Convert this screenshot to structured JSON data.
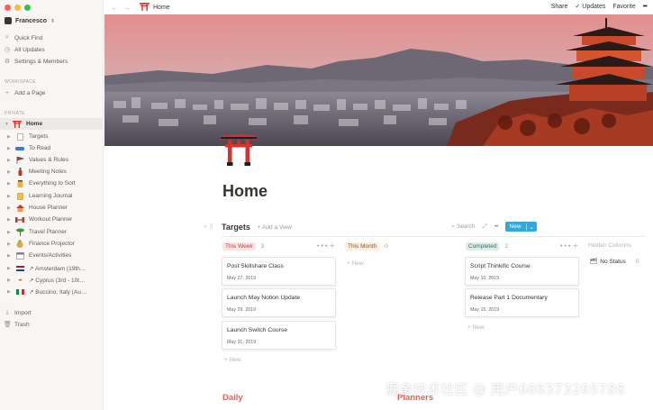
{
  "window": {
    "traffic_colors": [
      "#ff5f57",
      "#febc2e",
      "#28c840"
    ]
  },
  "sidebar": {
    "workspace": "Francesco",
    "top_items": [
      {
        "icon": "search-icon",
        "label": "Quick Find"
      },
      {
        "icon": "clock-icon",
        "label": "All Updates"
      },
      {
        "icon": "gear-icon",
        "label": "Settings & Members"
      }
    ],
    "workspace_label": "WORKSPACE",
    "add_page": "Add a Page",
    "private_label": "PRIVATE",
    "pages": [
      {
        "label": "Home",
        "icon": "torii-icon",
        "active": true,
        "indent": 0
      },
      {
        "label": "Targets",
        "icon": "document-icon",
        "indent": 1
      },
      {
        "label": "To Read",
        "icon": "car-icon",
        "indent": 1
      },
      {
        "label": "Values & Rules",
        "icon": "flag-icon",
        "indent": 1
      },
      {
        "label": "Meeting Notes",
        "icon": "bottle-icon",
        "indent": 1
      },
      {
        "label": "Everything to Sort",
        "icon": "jar-icon",
        "indent": 1
      },
      {
        "label": "Learning Journal",
        "icon": "notebook-icon",
        "indent": 1
      },
      {
        "label": "House Planner",
        "icon": "house-icon",
        "indent": 1
      },
      {
        "label": "Workout Planner",
        "icon": "dumbbell-icon",
        "indent": 1
      },
      {
        "label": "Travel Planner",
        "icon": "palm-tree-icon",
        "indent": 1
      },
      {
        "label": "Finance Projector",
        "icon": "money-bag-icon",
        "indent": 1
      },
      {
        "label": "Events/Activities",
        "icon": "calendar-icon",
        "indent": 1
      },
      {
        "label": "↗ Amsterdam (19th…",
        "icon": "netherlands-flag-icon",
        "indent": 1
      },
      {
        "label": "↗ Cyprus (3rd - 10t…",
        "icon": "cyprus-flag-icon",
        "indent": 1
      },
      {
        "label": "↗ Buccino, Italy (Au…",
        "icon": "italy-flag-icon",
        "indent": 1
      }
    ],
    "bottom_items": [
      {
        "icon": "import-icon",
        "label": "Import"
      },
      {
        "icon": "trash-icon",
        "label": "Trash"
      }
    ]
  },
  "topbar": {
    "breadcrumb": "Home",
    "share": "Share",
    "updates": "Updates",
    "favorite": "Favorite",
    "more": "•••"
  },
  "page": {
    "title": "Home"
  },
  "board": {
    "title": "Targets",
    "add_view": "+ Add a View",
    "search": "Search",
    "more": "•••",
    "new_label": "New",
    "add_new": "+ New",
    "hidden_columns": "Hidden Columns",
    "columns": [
      {
        "label": "This Week",
        "count": "3",
        "tag_bg": "#fbe4e4",
        "tag_color": "#b34a45"
      },
      {
        "label": "This Month",
        "count": "0",
        "tag_bg": "#fbeee0",
        "tag_color": "#8a5a2b"
      },
      {
        "label": "Completed",
        "count": "2",
        "tag_bg": "#ddedea",
        "tag_color": "#3f6e63"
      }
    ],
    "cards_this_week": [
      {
        "title": "Post Skillshare Class",
        "date": "May 27, 2019"
      },
      {
        "title": "Launch May Notion Update",
        "date": "May 29, 2019"
      },
      {
        "title": "Launch Switch Course",
        "date": "May 31, 2019"
      }
    ],
    "cards_completed": [
      {
        "title": "Script Thinkific Course",
        "date": "May 10, 2019"
      },
      {
        "title": "Release Part 1 Documentary",
        "date": "May 15, 2019"
      }
    ],
    "no_status": {
      "label": "No Status",
      "count": "0"
    }
  },
  "sections": {
    "daily": "Daily",
    "planners": "Planners"
  },
  "watermark": "掘金技术社区 @ 用户686373265788"
}
